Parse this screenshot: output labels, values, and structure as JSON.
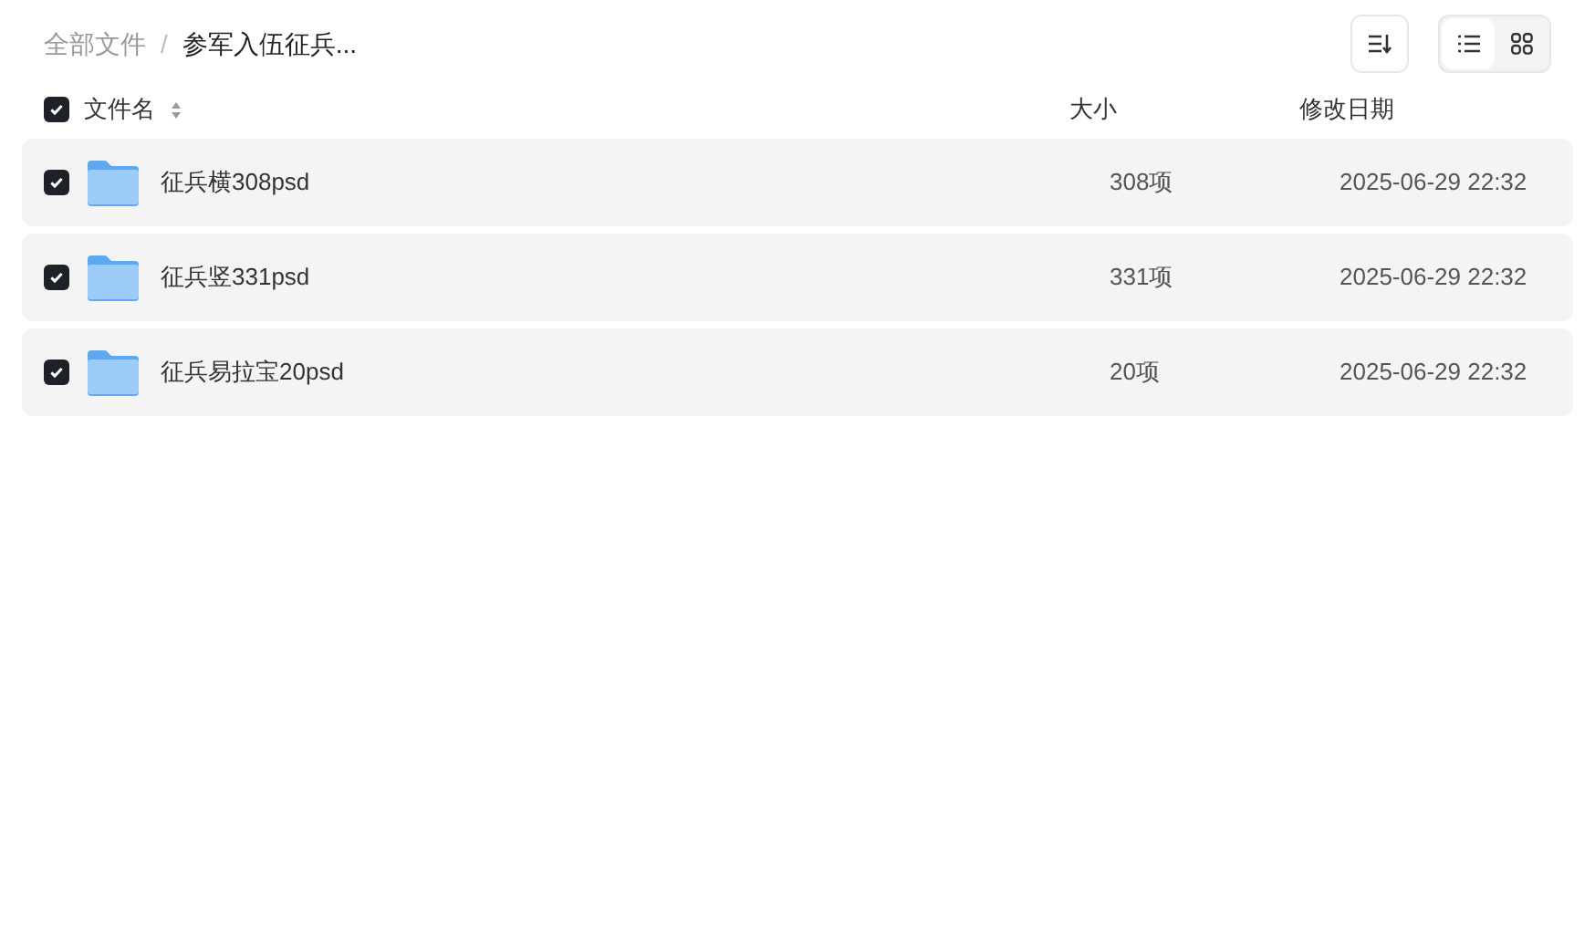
{
  "breadcrumb": [
    {
      "label": "全部文件",
      "current": false
    },
    {
      "separator": "/",
      "label": "参军入伍征兵...",
      "current": true
    }
  ],
  "view_toggle": [
    {
      "kind": "list",
      "selected": true
    },
    {
      "kind": "grid",
      "selected": false
    }
  ],
  "header": {
    "checked": true,
    "columns": [
      "文件名",
      "大小",
      "修改日期"
    ]
  },
  "rows": [
    {
      "name": "征兵横308psd",
      "size": "308项",
      "date": "2025-06-29 22:32",
      "checked": true
    },
    {
      "name": "征兵竖331psd",
      "size": "331项",
      "date": "2025-06-29 22:32",
      "checked": true
    },
    {
      "name": "征兵易拉宝20psd",
      "size": "20项",
      "date": "2025-06-29 22:32",
      "checked": true
    }
  ]
}
